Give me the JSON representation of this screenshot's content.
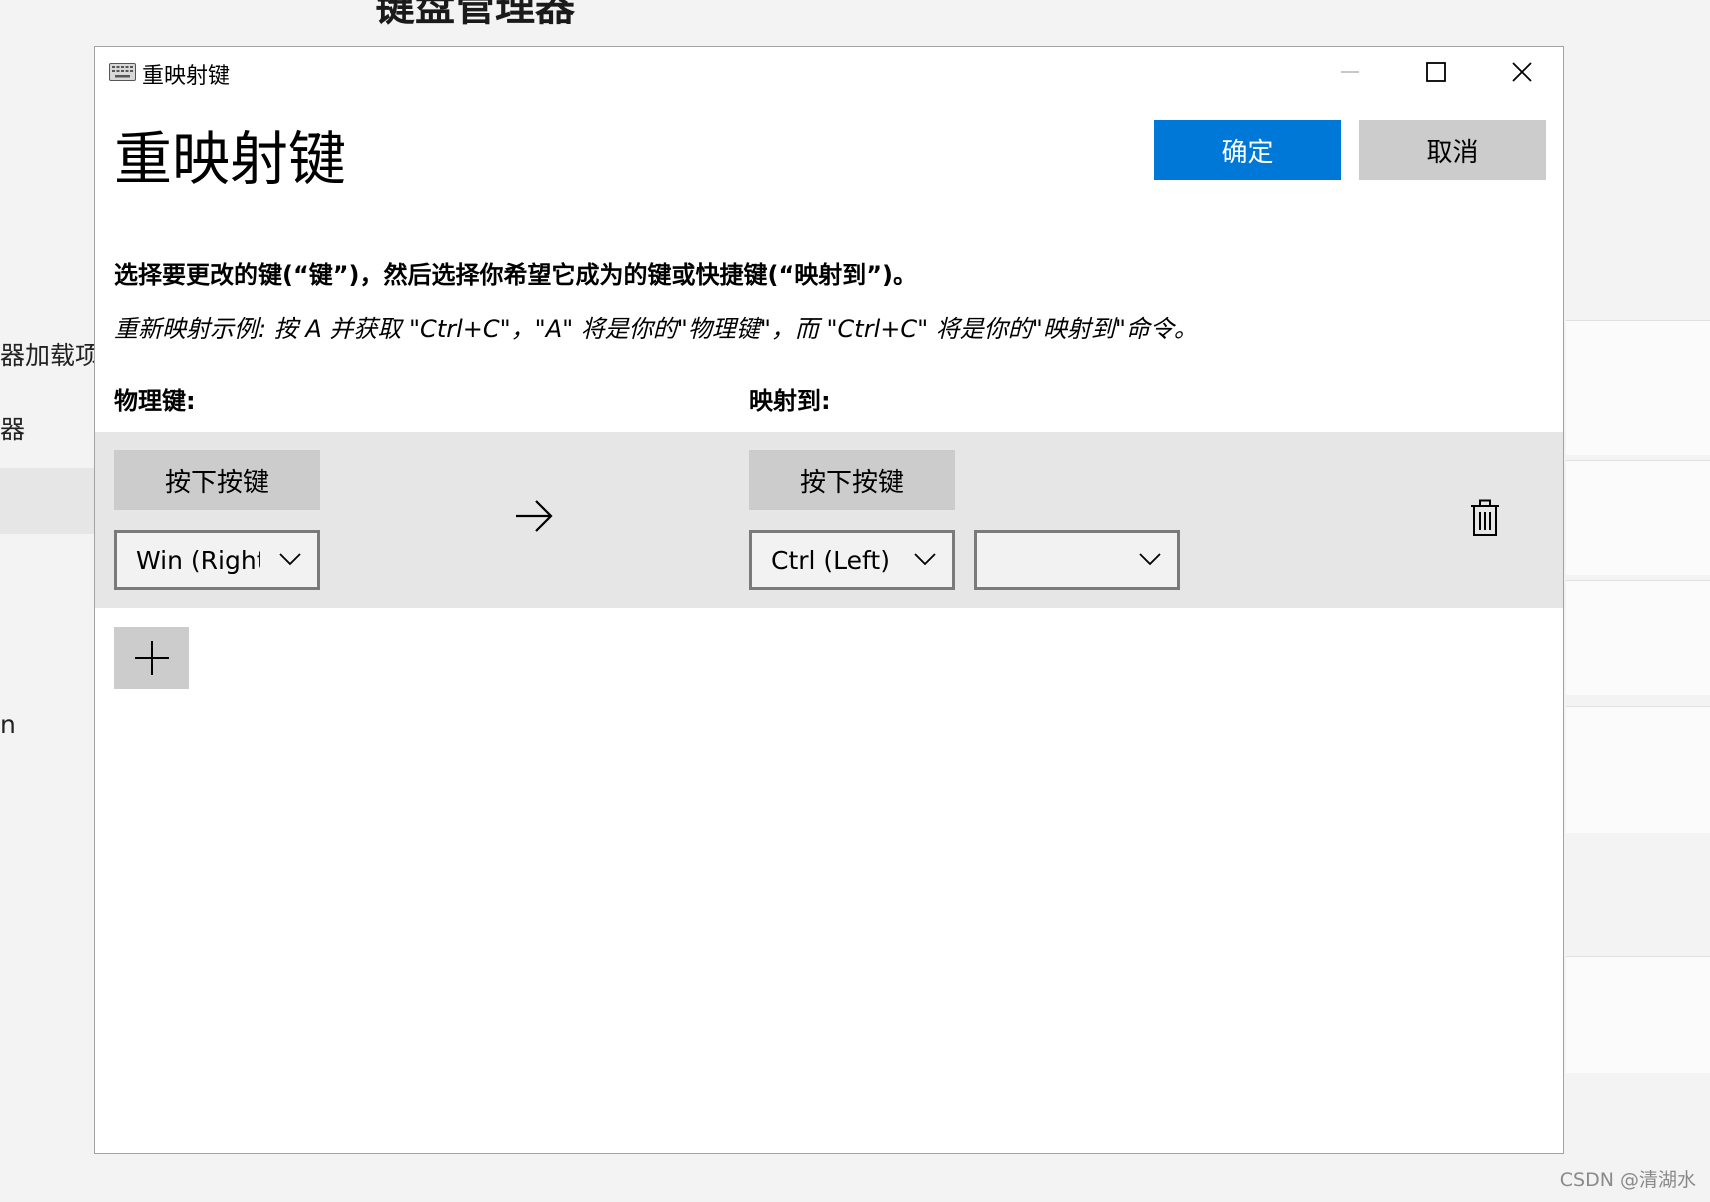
{
  "background": {
    "title": "键盘管理器",
    "left_items": [
      "器加载项",
      "器",
      "n"
    ],
    "watermark": "CSDN @清湖水"
  },
  "dialog": {
    "window_title": "重映射键",
    "heading": "重映射键",
    "ok_label": "确定",
    "cancel_label": "取消",
    "instruction": "选择要更改的键(“键”)，然后选择你希望它成为的键或快捷键(“映射到”)。",
    "example": "重新映射示例: 按 A 并获取 \"Ctrl+C\"，\"A\" 将是你的\"物理键\"，而 \"Ctrl+C\" 将是你的\"映射到\"命令。",
    "physical_header": "物理键:",
    "mapped_header": "映射到:",
    "mappings": [
      {
        "press_label": "按下按键",
        "physical_key": "Win (Right)",
        "map_press_label": "按下按键",
        "mapped_key_1": "Ctrl (Left)",
        "mapped_key_2": ""
      }
    ]
  },
  "colors": {
    "accent": "#0078d7",
    "button_gray": "#cccccc",
    "row_background": "#e6e6e6"
  },
  "icons": {
    "app": "keyboard-icon",
    "arrow": "arrow-right-icon",
    "delete": "trash-icon",
    "add": "plus-icon"
  }
}
